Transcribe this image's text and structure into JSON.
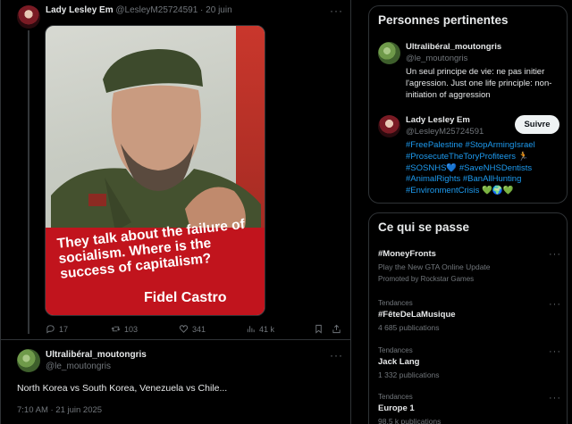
{
  "tweet1": {
    "author_name": "Lady Lesley Em",
    "author_handle": "@LesleyM25724591",
    "separator": "·",
    "date": "20 juin",
    "image": {
      "quote": "They talk about the failure of socialism. Where is the success of capitalism?",
      "author": "Fidel Castro",
      "colors": {
        "banner": "#c1141d",
        "flag": "#c9372c"
      }
    },
    "actions": {
      "replies": "17",
      "retweets": "103",
      "likes": "341",
      "views": "41 k"
    }
  },
  "tweet2": {
    "author_name": "Ultralibéral_moutongris",
    "author_handle": "@le_moutongris",
    "text": "North Korea vs South Korea, Venezuela vs Chile...",
    "timestamp": "7:10 AM · 21 juin 2025"
  },
  "sidebar": {
    "relevant_people": {
      "title": "Personnes pertinentes",
      "people": [
        {
          "name": "Ultralibéral_moutongris",
          "handle": "@le_moutongris",
          "bio": "Un seul principe de vie: ne pas initier l'agression. Just one life principle: non-initiation of aggression"
        },
        {
          "name": "Lady Lesley Em",
          "handle": "@LesleyM25724591",
          "follow_label": "Suivre",
          "bio_hashtags": "#FreePalestine #StopArmingIsrael #ProsecuteTheToryProfiteers 🏃 #SOSNHS💙 #SaveNHSDentists #AnimalRights #BanAllHunting #EnvironmentCrisis 💚🌍💚"
        }
      ]
    },
    "whats_happening": {
      "title": "Ce qui se passe",
      "trends": [
        {
          "meta": "",
          "name": "#MoneyFronts",
          "sub": "Play the New GTA Online Update",
          "sub2": "Promoted by Rockstar Games"
        },
        {
          "meta": "Tendances",
          "name": "#FêteDeLaMusique",
          "sub": "4 685 publications",
          "sub2": ""
        },
        {
          "meta": "Tendances",
          "name": "Jack Lang",
          "sub": "1 332 publications",
          "sub2": ""
        },
        {
          "meta": "Tendances",
          "name": "Europe 1",
          "sub": "98,5 k publications",
          "sub2": ""
        }
      ]
    }
  },
  "icons": {
    "reply": "reply-icon",
    "retweet": "retweet-icon",
    "like": "heart-icon",
    "views": "views-icon",
    "bookmark": "bookmark-icon",
    "share": "share-icon",
    "more": "more-icon"
  },
  "more_label": "···"
}
